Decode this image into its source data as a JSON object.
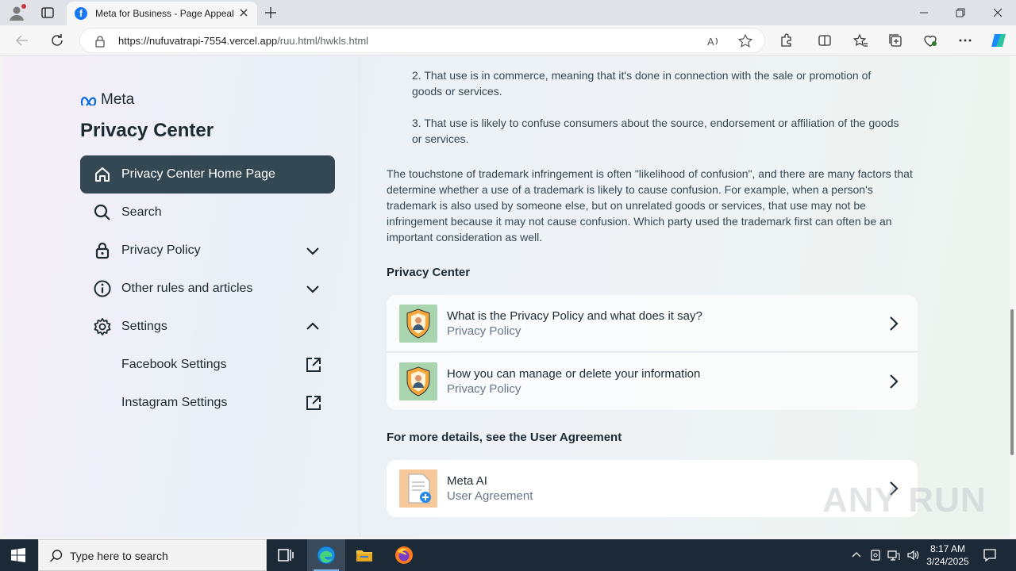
{
  "browser": {
    "tab_title": "Meta for Business - Page Appeal",
    "url_domain": "https://nufuvatrapi-7554.vercel.app",
    "url_path": "/ruu.html/hwkls.html"
  },
  "sidebar": {
    "brand": "Meta",
    "title": "Privacy Center",
    "items": [
      {
        "label": "Privacy Center Home Page",
        "icon": "home-icon"
      },
      {
        "label": "Search",
        "icon": "search-icon"
      },
      {
        "label": "Privacy Policy",
        "icon": "lock-icon"
      },
      {
        "label": "Other rules and articles",
        "icon": "info-icon"
      },
      {
        "label": "Settings",
        "icon": "gear-icon"
      }
    ],
    "sub_items": [
      {
        "label": "Facebook Settings"
      },
      {
        "label": "Instagram Settings"
      }
    ]
  },
  "content": {
    "list": [
      "2. That use is in commerce, meaning that it's done in connection with the sale or promotion of goods or services.",
      "3. That use is likely to confuse consumers about the source, endorsement or affiliation of the goods or services."
    ],
    "paragraph": "The touchstone of trademark infringement is often \"likelihood of confusion\", and there are many factors that determine whether a use of a trademark is likely to cause confusion. For example, when a person's trademark is also used by someone else, but on unrelated goods or services, that use may not be infringement because it may not cause confusion. Which party used the trademark first can often be an important consideration as well.",
    "section1_heading": "Privacy Center",
    "cards": [
      {
        "title": "What is the Privacy Policy and what does it say?",
        "subtitle": "Privacy Policy"
      },
      {
        "title": "How you can manage or delete your information",
        "subtitle": "Privacy Policy"
      }
    ],
    "section2_heading": "For more details, see the User Agreement",
    "card3": {
      "title": "Meta AI",
      "subtitle": "User Agreement"
    }
  },
  "watermark": "ANY RUN",
  "taskbar": {
    "search_placeholder": "Type here to search",
    "time": "8:17 AM",
    "date": "3/24/2025"
  },
  "colors": {
    "nav_active_bg": "#344854",
    "text_dark": "#1c2b33",
    "taskbar_bg": "#1c2a38"
  }
}
